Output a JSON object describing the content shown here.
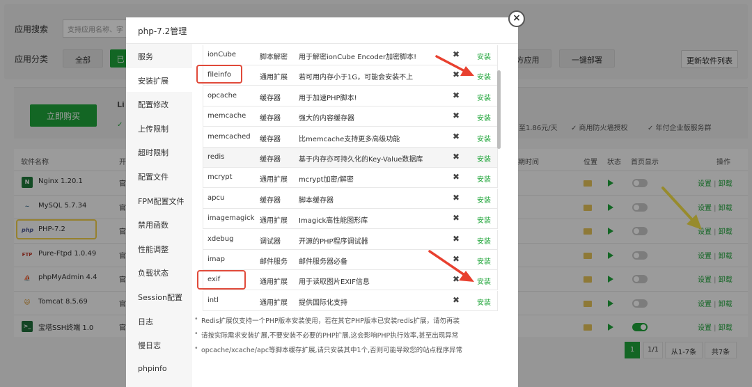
{
  "background": {
    "search_label": "应用搜索",
    "search_placeholder": "支持应用名称、字",
    "category_label": "应用分类",
    "categories": [
      {
        "label": "全部",
        "style": "gray"
      },
      {
        "label": "已",
        "style": "green"
      },
      {
        "label": "方应用",
        "style": "gray"
      },
      {
        "label": "一键部署",
        "style": "gray"
      }
    ],
    "update_btn": "更新软件列表",
    "buy_btn": "立即购买",
    "promo_prefix": "Li",
    "promo_items": [
      "至1.86元/天",
      "✓ 商用防火墙授权",
      "✓ 年付企业版服务群"
    ],
    "table_headers": {
      "name": "软件名称",
      "col2": "开",
      "expire": "期时间",
      "location": "位置",
      "status": "状态",
      "home": "首页显示",
      "ops": "操作"
    },
    "software": [
      {
        "name": "Nginx 1.20.1",
        "icon": "nginx-icon",
        "icon_text": "N",
        "toggle": false
      },
      {
        "name": "MySQL 5.7.34",
        "icon": "mysql-icon",
        "icon_text": "~",
        "toggle": false
      },
      {
        "name": "PHP-7.2",
        "icon": "php-icon",
        "icon_text": "php",
        "toggle": false
      },
      {
        "name": "Pure-Ftpd 1.0.49",
        "icon": "ftp-icon",
        "icon_text": "FTP",
        "toggle": false
      },
      {
        "name": "phpMyAdmin 4.4",
        "icon": "phpmyadmin-icon",
        "icon_text": "⛵",
        "toggle": false
      },
      {
        "name": "Tomcat 8.5.69",
        "icon": "tomcat-icon",
        "icon_text": "🐱",
        "toggle": false
      },
      {
        "name": "宝塔SSH终端 1.0",
        "icon": "terminal-icon",
        "icon_text": ">_",
        "toggle": true
      }
    ],
    "row_official": "官",
    "op_settings": "设置",
    "op_sep": "|",
    "op_uninstall": "卸载",
    "pager": {
      "page": "1",
      "total_pages": "1/1",
      "range": "从1-7条",
      "total": "共7条"
    }
  },
  "modal": {
    "title": "php-7.2管理",
    "close": "×",
    "menu": [
      "服务",
      "安装扩展",
      "配置修改",
      "上传限制",
      "超时限制",
      "配置文件",
      "FPM配置文件",
      "禁用函数",
      "性能调整",
      "负载状态",
      "Session配置",
      "日志",
      "慢日志",
      "phpinfo"
    ],
    "active_menu_index": 1,
    "x_mark": "✖",
    "install": "安装",
    "extensions": [
      {
        "name": "ionCube",
        "type": "脚本解密",
        "desc": "用于解密ionCube Encoder加密脚本!"
      },
      {
        "name": "fileinfo",
        "type": "通用扩展",
        "desc": "若可用内存小于1G，可能会安装不上"
      },
      {
        "name": "opcache",
        "type": "缓存器",
        "desc": "用于加速PHP脚本!"
      },
      {
        "name": "memcache",
        "type": "缓存器",
        "desc": "强大的内容缓存器"
      },
      {
        "name": "memcached",
        "type": "缓存器",
        "desc": "比memcache支持更多高级功能"
      },
      {
        "name": "redis",
        "type": "缓存器",
        "desc": "基于内存亦可持久化的Key-Value数据库"
      },
      {
        "name": "mcrypt",
        "type": "通用扩展",
        "desc": "mcrypt加密/解密"
      },
      {
        "name": "apcu",
        "type": "缓存器",
        "desc": "脚本缓存器"
      },
      {
        "name": "imagemagick",
        "type": "通用扩展",
        "desc": "Imagick高性能图形库"
      },
      {
        "name": "xdebug",
        "type": "调试器",
        "desc": "开源的PHP程序调试器"
      },
      {
        "name": "imap",
        "type": "邮件服务",
        "desc": "邮件服务器必备"
      },
      {
        "name": "exif",
        "type": "通用扩展",
        "desc": "用于读取图片EXIF信息"
      },
      {
        "name": "intl",
        "type": "通用扩展",
        "desc": "提供国际化支持"
      }
    ],
    "notes": [
      "Redis扩展仅支持一个PHP版本安装使用，若在其它PHP版本已安装redis扩展，请勿再装",
      "请按实际需求安装扩展,不要安装不必要的PHP扩展,这会影响PHP执行效率,甚至出现异常",
      "opcache/xcache/apc等脚本缓存扩展,请只安装其中1个,否则可能导致您的站点程序异常"
    ]
  }
}
